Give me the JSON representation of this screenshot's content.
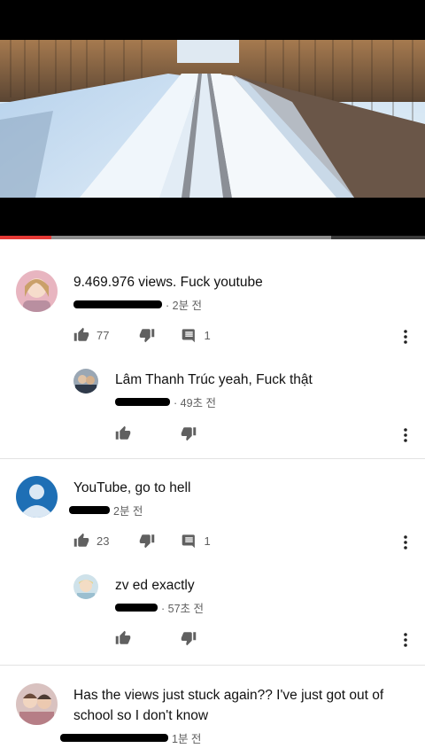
{
  "player": {
    "progress": 0.12,
    "buffered": 0.78,
    "colors": {
      "progress": "#e53935",
      "buffer": "#8c8c8c",
      "track": "#3a3a3a"
    }
  },
  "comments": [
    {
      "text": "9.469.976 views. Fuck youtube",
      "time": "· 2분 전",
      "likes": "77",
      "replies": "1",
      "avatar": "pink-portrait-avatar",
      "reply": {
        "text": "Lâm Thanh Trúc yeah, Fuck thật",
        "time": "· 49초 전",
        "avatar": "group-photo-avatar"
      }
    },
    {
      "text": "YouTube, go to hell",
      "time": "2분 전",
      "likes": "23",
      "replies": "1",
      "avatar": "default-person-avatar",
      "reply": {
        "text": "zv ed exactly",
        "time": "· 57초 전",
        "avatar": "light-portrait-avatar"
      }
    },
    {
      "text": "Has the views just stuck again?? I've just got out of school so I don't know",
      "time": "1분 전",
      "avatar": "couple-photo-avatar"
    }
  ]
}
